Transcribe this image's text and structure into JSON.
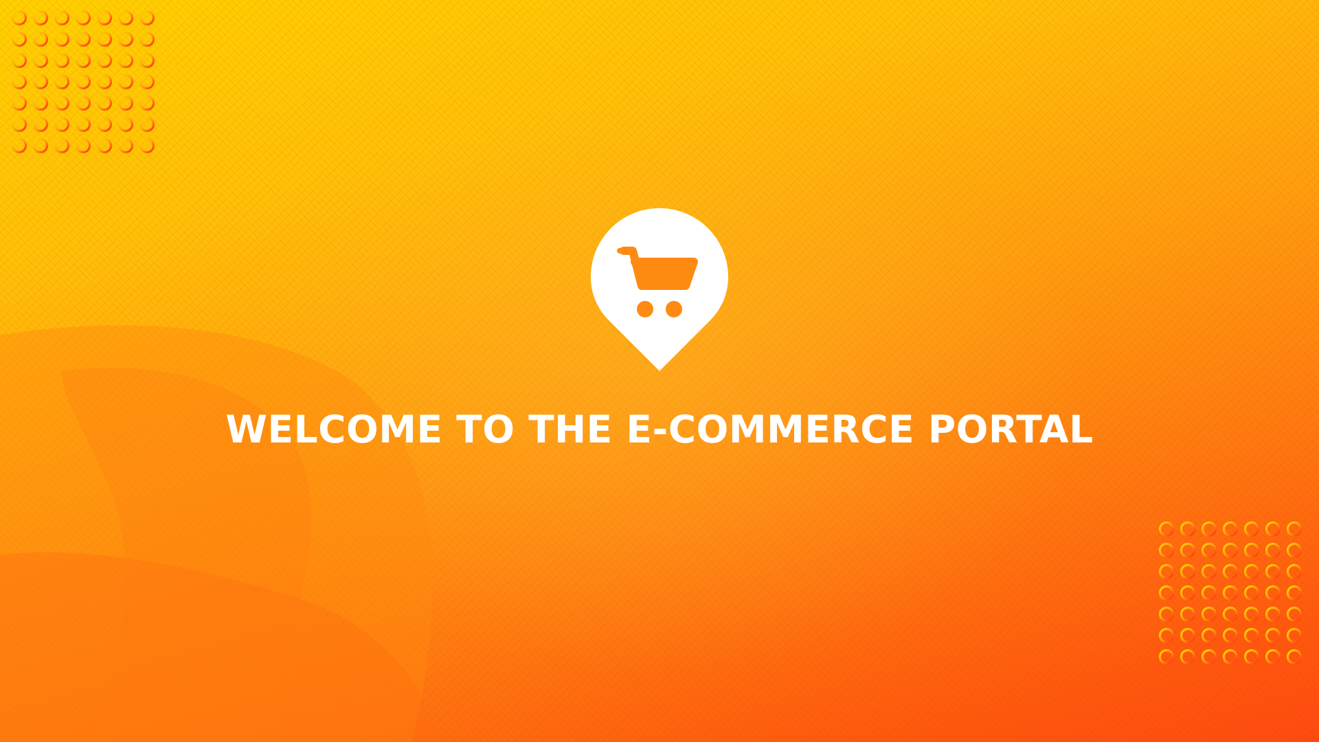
{
  "headline": "WELCOME TO THE E-COMMERCE PORTAL",
  "logo_icon": "shopping-cart-location-pin-icon",
  "colors": {
    "background_top": "#ffd000",
    "background_bottom": "#ff4a10",
    "ring_yellow": "#ffd800",
    "ring_red": "#ff2a10",
    "text": "#ffffff"
  }
}
